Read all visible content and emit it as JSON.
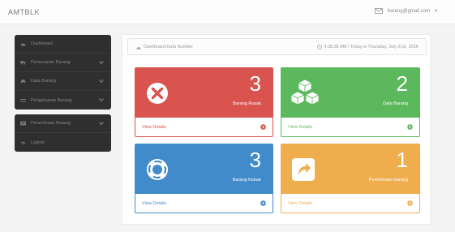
{
  "app": {
    "brand": "AMTBLK",
    "user_email": "barang@gmail.com",
    "user_caret": "▾"
  },
  "sidebar": {
    "groups": [
      {
        "items": [
          {
            "label": "Dashboard",
            "icon": "dashboard-icon",
            "has_children": false
          },
          {
            "label": "Pemesanan Barang",
            "icon": "truck-icon",
            "has_children": true
          },
          {
            "label": "Data Barang",
            "icon": "car-icon",
            "has_children": true
          },
          {
            "label": "Pengeluaran Barang",
            "icon": "list-icon",
            "has_children": true
          }
        ]
      },
      {
        "items": [
          {
            "label": "Penerimaan Barang",
            "icon": "inbox-icon",
            "has_children": true
          },
          {
            "label": "Logout",
            "icon": "logout-icon",
            "has_children": false
          }
        ]
      }
    ]
  },
  "infobar": {
    "title": "Dashboard Data Number",
    "datetime": "4:28:35 AM / Today is Thursday, July 21st, 2016"
  },
  "cards": [
    {
      "value": "3",
      "label": "Barang Rusak",
      "link": "View Details",
      "color": "#d9534f",
      "icon": "close-circle-icon"
    },
    {
      "value": "2",
      "label": "Data Barang",
      "link": "View Details",
      "color": "#5cb85c",
      "icon": "cubes-icon"
    },
    {
      "value": "3",
      "label": "Barang Keluar",
      "link": "View Details",
      "color": "#428bca",
      "icon": "lifebuoy-icon"
    },
    {
      "value": "1",
      "label": "Penerimaan barang",
      "link": "View Details",
      "color": "#f0ad4e",
      "icon": "share-icon"
    }
  ]
}
